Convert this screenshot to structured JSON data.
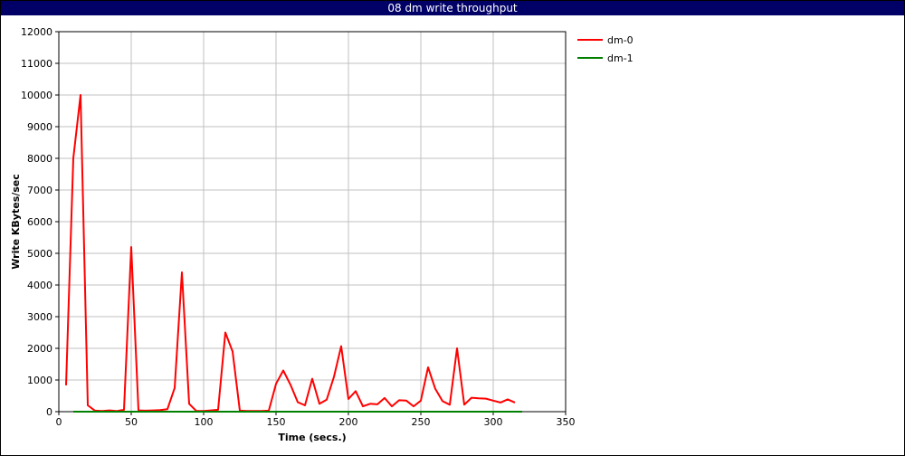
{
  "chart_data": {
    "type": "line",
    "title": "08 dm write throughput",
    "xlabel": "Time (secs.)",
    "ylabel": "Write KBytes/sec",
    "xlim": [
      0,
      350
    ],
    "ylim": [
      0,
      12000
    ],
    "xticks": [
      0,
      50,
      100,
      150,
      200,
      250,
      300,
      350
    ],
    "yticks": [
      0,
      1000,
      2000,
      3000,
      4000,
      5000,
      6000,
      7000,
      8000,
      9000,
      10000,
      11000,
      12000
    ],
    "grid": true,
    "legend_position": "top-right",
    "series": [
      {
        "name": "dm-0",
        "color": "#ff0000",
        "x": [
          5,
          10,
          15,
          20,
          25,
          30,
          35,
          40,
          45,
          50,
          55,
          60,
          65,
          70,
          75,
          80,
          85,
          90,
          95,
          100,
          105,
          110,
          115,
          120,
          125,
          130,
          135,
          140,
          145,
          150,
          155,
          160,
          165,
          170,
          175,
          180,
          185,
          190,
          195,
          200,
          205,
          210,
          215,
          220,
          225,
          230,
          235,
          240,
          245,
          250,
          255,
          260,
          265,
          270,
          275,
          280,
          285,
          290,
          295,
          300,
          305,
          310,
          315
        ],
        "values": [
          830,
          8000,
          10000,
          200,
          30,
          20,
          40,
          20,
          60,
          5200,
          40,
          30,
          40,
          50,
          80,
          750,
          4400,
          250,
          20,
          20,
          40,
          60,
          2500,
          1900,
          30,
          20,
          20,
          20,
          30,
          880,
          1300,
          850,
          300,
          200,
          1040,
          250,
          380,
          1100,
          2070,
          400,
          650,
          170,
          250,
          230,
          430,
          170,
          360,
          350,
          170,
          350,
          1400,
          720,
          330,
          220,
          2000,
          220,
          440,
          420,
          410,
          350,
          290,
          390,
          290
        ]
      },
      {
        "name": "dm-1",
        "color": "#008000",
        "x": [
          10,
          320
        ],
        "values": [
          0,
          0
        ]
      }
    ]
  }
}
